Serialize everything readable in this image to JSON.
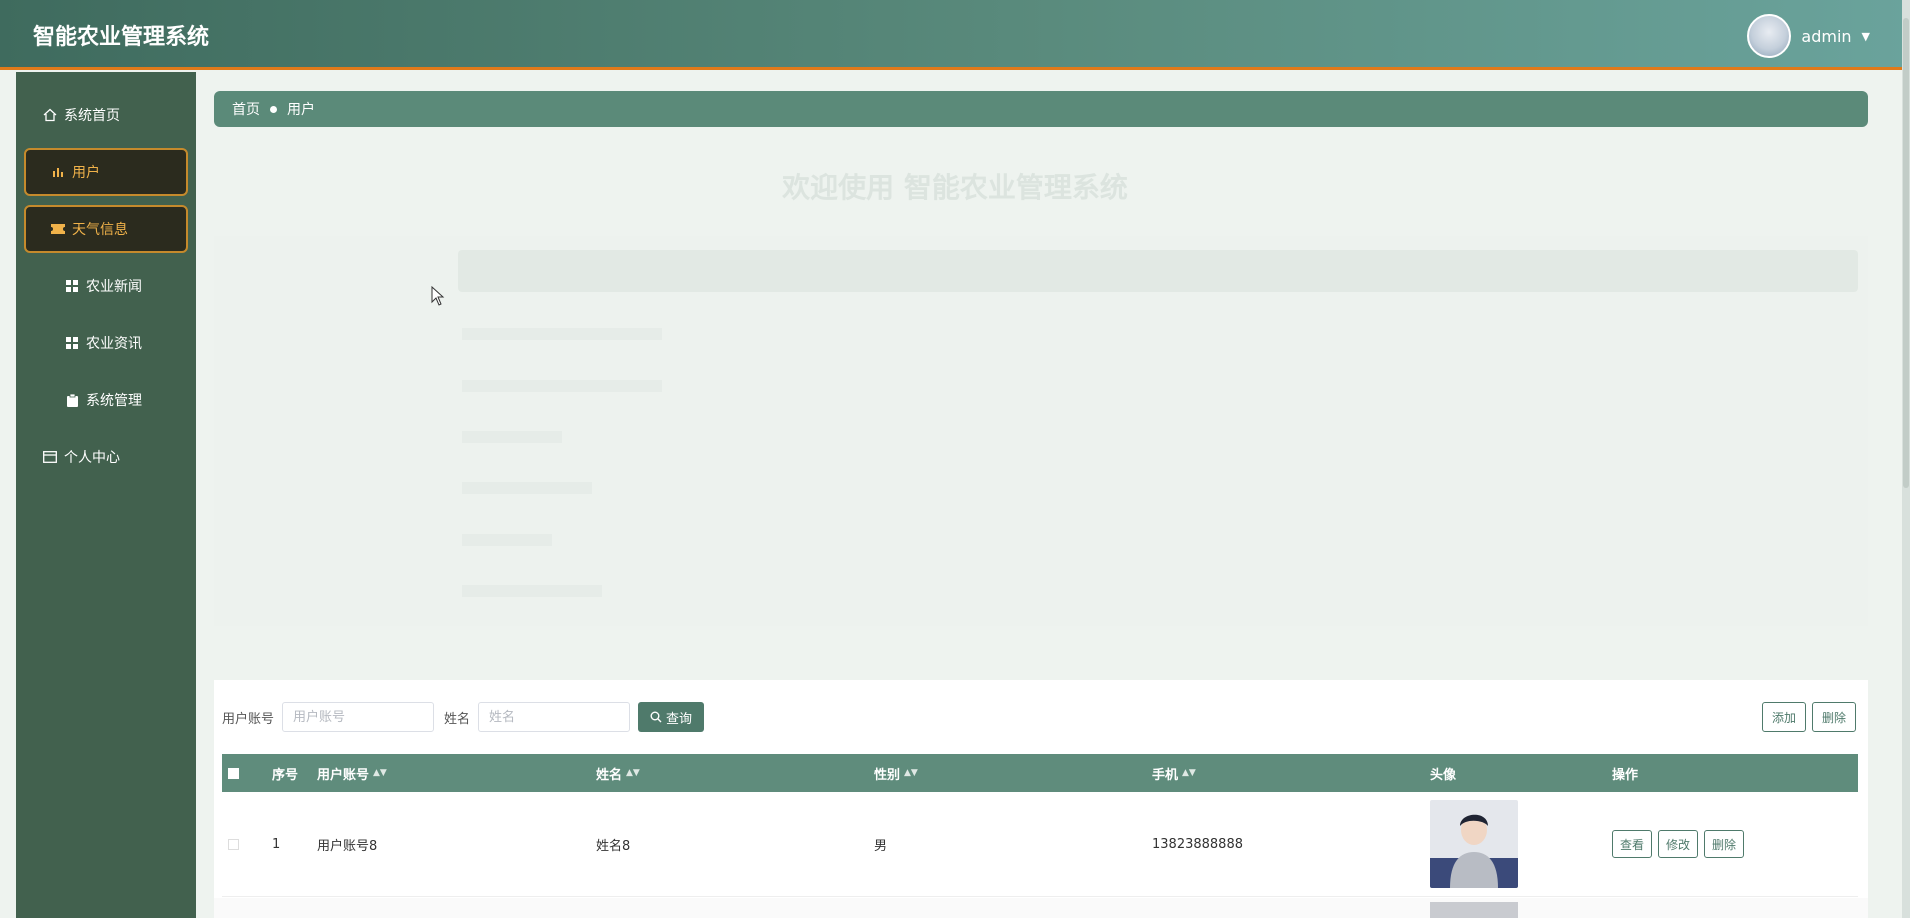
{
  "header": {
    "title": "智能农业管理系统",
    "user": "admin"
  },
  "sidebar": {
    "items": [
      {
        "label": "系统首页",
        "icon": "home-icon"
      },
      {
        "label": "用户",
        "icon": "bar-chart-icon"
      },
      {
        "label": "天气信息",
        "icon": "ticket-icon"
      },
      {
        "label": "农业新闻",
        "icon": "grid-icon"
      },
      {
        "label": "农业资讯",
        "icon": "grid-icon"
      },
      {
        "label": "系统管理",
        "icon": "clipboard-icon"
      },
      {
        "label": "个人中心",
        "icon": "card-icon"
      }
    ]
  },
  "breadcrumb": {
    "home": "首页",
    "current": "用户"
  },
  "welcome": {
    "title": "欢迎使用 智能农业管理系统"
  },
  "search": {
    "account_label": "用户账号",
    "account_placeholder": "用户账号",
    "name_label": "姓名",
    "name_placeholder": "姓名",
    "query_button": "查询"
  },
  "actions": {
    "add": "添加",
    "delete": "删除"
  },
  "table": {
    "columns": [
      "序号",
      "用户账号",
      "姓名",
      "性别",
      "手机",
      "头像",
      "操作"
    ],
    "rows": [
      {
        "index": "1",
        "account": "用户账号8",
        "name": "姓名8",
        "gender": "男",
        "phone": "13823888888",
        "ops": [
          "查看",
          "修改",
          "删除"
        ]
      }
    ]
  }
}
